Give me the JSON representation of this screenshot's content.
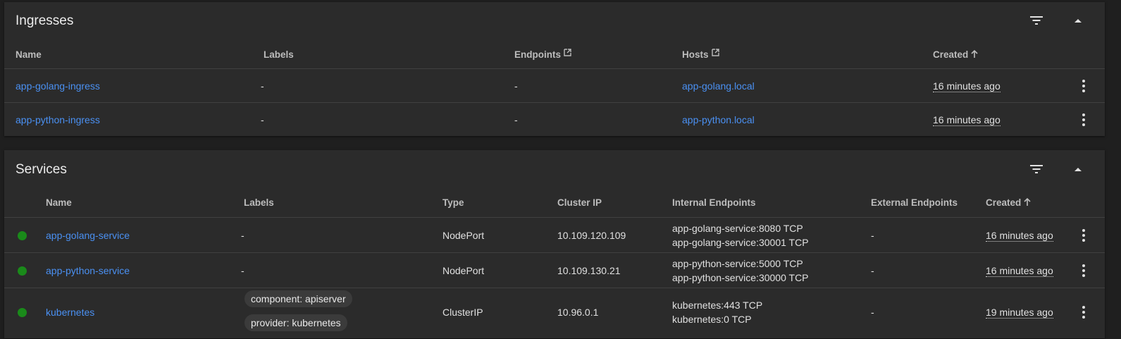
{
  "ingresses": {
    "title": "Ingresses",
    "columns": {
      "name": "Name",
      "labels": "Labels",
      "endpoints": "Endpoints",
      "hosts": "Hosts",
      "created": "Created"
    },
    "rows": [
      {
        "name": "app-golang-ingress",
        "labels": "-",
        "endpoints": "-",
        "hosts": "app-golang.local",
        "created": "16 minutes ago"
      },
      {
        "name": "app-python-ingress",
        "labels": "-",
        "endpoints": "-",
        "hosts": "app-python.local",
        "created": "16 minutes ago"
      }
    ]
  },
  "services": {
    "title": "Services",
    "columns": {
      "name": "Name",
      "labels": "Labels",
      "type": "Type",
      "cluster_ip": "Cluster IP",
      "internal_endpoints": "Internal Endpoints",
      "external_endpoints": "External Endpoints",
      "created": "Created"
    },
    "rows": [
      {
        "status": "ok",
        "name": "app-golang-service",
        "labels": "-",
        "type": "NodePort",
        "cluster_ip": "10.109.120.109",
        "internal_endpoints": [
          "app-golang-service:8080 TCP",
          "app-golang-service:30001 TCP"
        ],
        "external_endpoints": "-",
        "created": "16 minutes ago"
      },
      {
        "status": "ok",
        "name": "app-python-service",
        "labels": "-",
        "type": "NodePort",
        "cluster_ip": "10.109.130.21",
        "internal_endpoints": [
          "app-python-service:5000 TCP",
          "app-python-service:30000 TCP"
        ],
        "external_endpoints": "-",
        "created": "16 minutes ago"
      },
      {
        "status": "ok",
        "name": "kubernetes",
        "labels": [
          "component: apiserver",
          "provider: kubernetes"
        ],
        "type": "ClusterIP",
        "cluster_ip": "10.96.0.1",
        "internal_endpoints": [
          "kubernetes:443 TCP",
          "kubernetes:0 TCP"
        ],
        "external_endpoints": "-",
        "created": "19 minutes ago"
      }
    ]
  },
  "colors": {
    "link": "#4a90f2",
    "status_ok": "#1a8a1a",
    "card_bg": "#2b2b2b",
    "page_bg": "#1f1f1f"
  },
  "icons": [
    "filter-icon",
    "collapse-icon",
    "external-link-icon",
    "sort-arrow-up-icon",
    "more-vert-icon",
    "status-dot-icon"
  ]
}
